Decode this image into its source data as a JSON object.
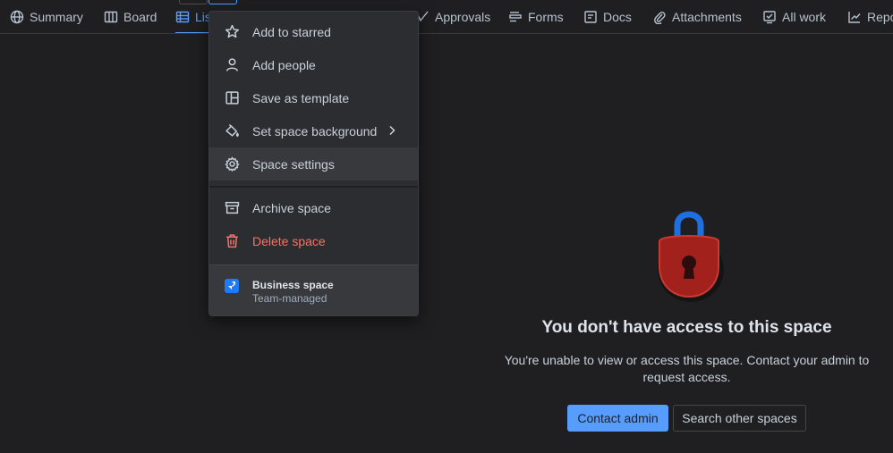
{
  "tabs": [
    {
      "label": "Summary",
      "icon": "globe-icon"
    },
    {
      "label": "Board",
      "icon": "board-icon"
    },
    {
      "label": "List",
      "icon": "list-icon",
      "active": true
    },
    {
      "label": "Approvals",
      "icon": "approvals-icon"
    },
    {
      "label": "Forms",
      "icon": "forms-icon"
    },
    {
      "label": "Docs",
      "icon": "docs-icon"
    },
    {
      "label": "Attachments",
      "icon": "paperclip-icon"
    },
    {
      "label": "All work",
      "icon": "all-work-icon"
    },
    {
      "label": "Repo",
      "icon": "chart-icon"
    }
  ],
  "menu": {
    "items": [
      {
        "label": "Add to starred",
        "icon": "star-icon"
      },
      {
        "label": "Add people",
        "icon": "person-icon"
      },
      {
        "label": "Save as template",
        "icon": "template-icon"
      },
      {
        "label": "Set space background",
        "icon": "paint-bucket-icon",
        "submenu": true
      },
      {
        "label": "Space settings",
        "icon": "gear-icon",
        "hovered": true
      },
      {
        "label": "Archive space",
        "icon": "archive-icon"
      },
      {
        "label": "Delete space",
        "icon": "trash-icon",
        "danger": true
      }
    ],
    "footer": {
      "name": "Business space",
      "type": "Team-managed"
    }
  },
  "empty_state": {
    "title": "You don't have access to this space",
    "description": "You're unable to view or access this space. Contact your admin to request access.",
    "primary_button": "Contact admin",
    "secondary_button": "Search other spaces"
  },
  "colors": {
    "background": "#1f1f21",
    "accent": "#579dff",
    "danger": "#f87168",
    "lock_body": "#a3211d",
    "lock_shackle": "#1f6fe0"
  }
}
